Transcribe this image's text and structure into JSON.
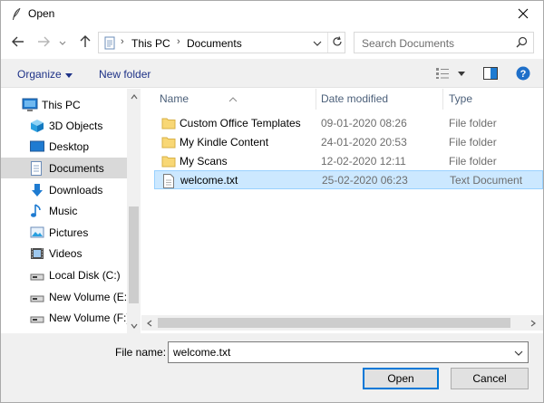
{
  "window": {
    "title": "Open"
  },
  "address": {
    "crumbs": [
      "This PC",
      "Documents"
    ]
  },
  "search": {
    "placeholder": "Search Documents"
  },
  "commandbar": {
    "organize": "Organize",
    "new_folder": "New folder"
  },
  "nav": {
    "items": [
      {
        "label": "This PC",
        "icon": "pc-icon",
        "level": "top",
        "selected": false
      },
      {
        "label": "3D Objects",
        "icon": "3d-objects-icon",
        "selected": false
      },
      {
        "label": "Desktop",
        "icon": "desktop-icon",
        "selected": false
      },
      {
        "label": "Documents",
        "icon": "documents-icon",
        "selected": true
      },
      {
        "label": "Downloads",
        "icon": "downloads-icon",
        "selected": false
      },
      {
        "label": "Music",
        "icon": "music-icon",
        "selected": false
      },
      {
        "label": "Pictures",
        "icon": "pictures-icon",
        "selected": false
      },
      {
        "label": "Videos",
        "icon": "videos-icon",
        "selected": false
      },
      {
        "label": "Local Disk (C:)",
        "icon": "drive-icon",
        "selected": false
      },
      {
        "label": "New Volume (E:)",
        "icon": "drive-icon",
        "selected": false
      },
      {
        "label": "New Volume (F:)",
        "icon": "drive-icon",
        "selected": false
      }
    ]
  },
  "files": {
    "columns": {
      "name": "Name",
      "date": "Date modified",
      "type": "Type"
    },
    "rows": [
      {
        "name": "Custom Office Templates",
        "date": "09-01-2020 08:26",
        "type": "File folder",
        "kind": "folder",
        "selected": false
      },
      {
        "name": "My Kindle Content",
        "date": "24-01-2020 20:53",
        "type": "File folder",
        "kind": "folder",
        "selected": false
      },
      {
        "name": "My Scans",
        "date": "12-02-2020 12:11",
        "type": "File folder",
        "kind": "folder",
        "selected": false
      },
      {
        "name": "welcome.txt",
        "date": "25-02-2020 06:23",
        "type": "Text Document",
        "kind": "text",
        "selected": true
      }
    ]
  },
  "footer": {
    "file_name_label": "File name:",
    "file_name_value": "welcome.txt",
    "open_label": "Open",
    "cancel_label": "Cancel"
  },
  "colors": {
    "accent": "#0078d7",
    "selected_row": "#cce8ff",
    "folder": "#f8d775",
    "link_text": "#1e3287"
  }
}
